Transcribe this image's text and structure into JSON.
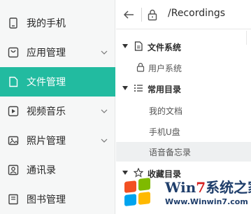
{
  "sidebar": {
    "items": [
      {
        "label": "我的手机",
        "icon": "phone-icon",
        "expandable": false,
        "active": false
      },
      {
        "label": "应用管理",
        "icon": "app-bag-icon",
        "expandable": true,
        "active": false
      },
      {
        "label": "文件管理",
        "icon": "file-icon",
        "expandable": false,
        "active": true
      },
      {
        "label": "视频音乐",
        "icon": "play-icon",
        "expandable": true,
        "active": false
      },
      {
        "label": "照片管理",
        "icon": "image-icon",
        "expandable": true,
        "active": false
      },
      {
        "label": "通讯录",
        "icon": "contact-card-icon",
        "expandable": false,
        "active": false
      },
      {
        "label": "图书管理",
        "icon": "book-icon",
        "expandable": false,
        "active": false
      }
    ]
  },
  "topbar": {
    "path": "/Recordings"
  },
  "tree": {
    "filesystem": {
      "label": "文件系统",
      "children": [
        {
          "label": "用户系统"
        }
      ]
    },
    "common": {
      "label": "常用目录",
      "children": [
        {
          "label": "我的文档"
        },
        {
          "label": "手机U盘"
        },
        {
          "label": "语音备忘录",
          "selected": true
        }
      ]
    },
    "favorites": {
      "label": "收藏目录"
    }
  },
  "watermark": {
    "title_prefix": "Win",
    "title_seven": "7",
    "title_suffix": "系统之家",
    "url": "Www.Winwin7.com"
  },
  "colors": {
    "accent": "#22bba0",
    "sidebar_bg": "#f6f7f7",
    "selected_row": "#eef0f1"
  }
}
